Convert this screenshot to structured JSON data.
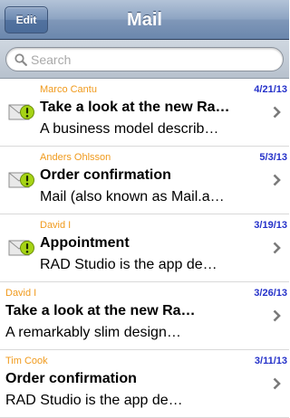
{
  "navbar": {
    "edit_label": "Edit",
    "title": "Mail"
  },
  "search": {
    "placeholder": "Search"
  },
  "icons": {
    "mail": "envelope-alert-icon",
    "disclosure": "chevron-right-icon",
    "search": "search-icon"
  },
  "colors": {
    "sender": "#f09a1c",
    "date": "#2431c9",
    "navbar": "#6b87ad",
    "alert_badge": "#a6d415"
  },
  "messages": [
    {
      "sender": "Marco Cantu",
      "date": "4/21/13",
      "subject": "Take a look at the new Ra…",
      "preview": "A business model describ…",
      "has_icon": true
    },
    {
      "sender": "Anders Ohlsson",
      "date": "5/3/13",
      "subject": "Order confirmation",
      "preview": "Mail (also known as Mail.a…",
      "has_icon": true
    },
    {
      "sender": "David I",
      "date": "3/19/13",
      "subject": "Appointment",
      "preview": "RAD Studio is the app de…",
      "has_icon": true
    },
    {
      "sender": "David I",
      "date": "3/26/13",
      "subject": "Take a look at the new Ra…",
      "preview": "A remarkably slim design…",
      "has_icon": false
    },
    {
      "sender": "Tim Cook",
      "date": "3/11/13",
      "subject": "Order confirmation",
      "preview": "RAD Studio is the app de…",
      "has_icon": false
    }
  ]
}
